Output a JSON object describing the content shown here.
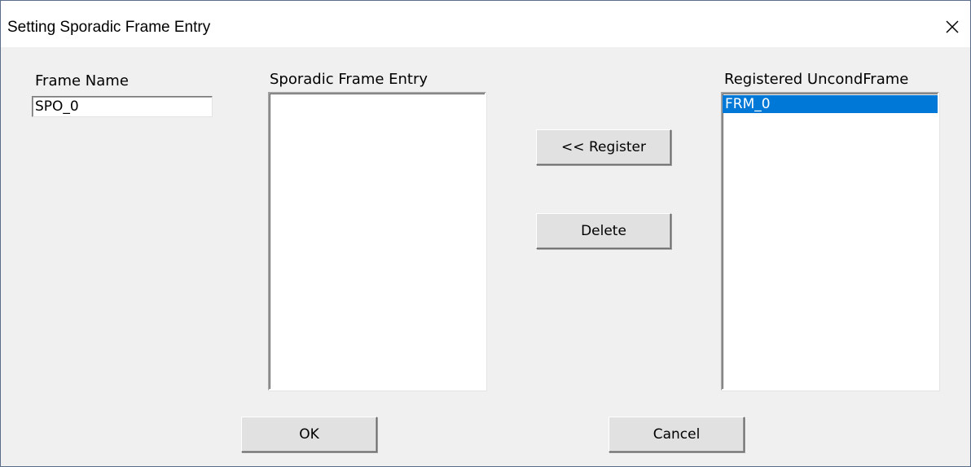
{
  "window": {
    "title": "Setting Sporadic Frame Entry",
    "close_glyph": "✕"
  },
  "frame_name": {
    "label": "Frame Name",
    "value": "SPO_0"
  },
  "sporadic_entry": {
    "label": "Sporadic Frame Entry",
    "items": []
  },
  "registered": {
    "label": "Registered UncondFrame",
    "items": [
      {
        "label": "FRM_0",
        "selected": true
      }
    ]
  },
  "buttons": {
    "register": "<< Register",
    "delete": "Delete",
    "ok": "OK",
    "cancel": "Cancel"
  },
  "colors": {
    "selection": "#0078d7",
    "dialog_bg": "#f0f0f0"
  }
}
